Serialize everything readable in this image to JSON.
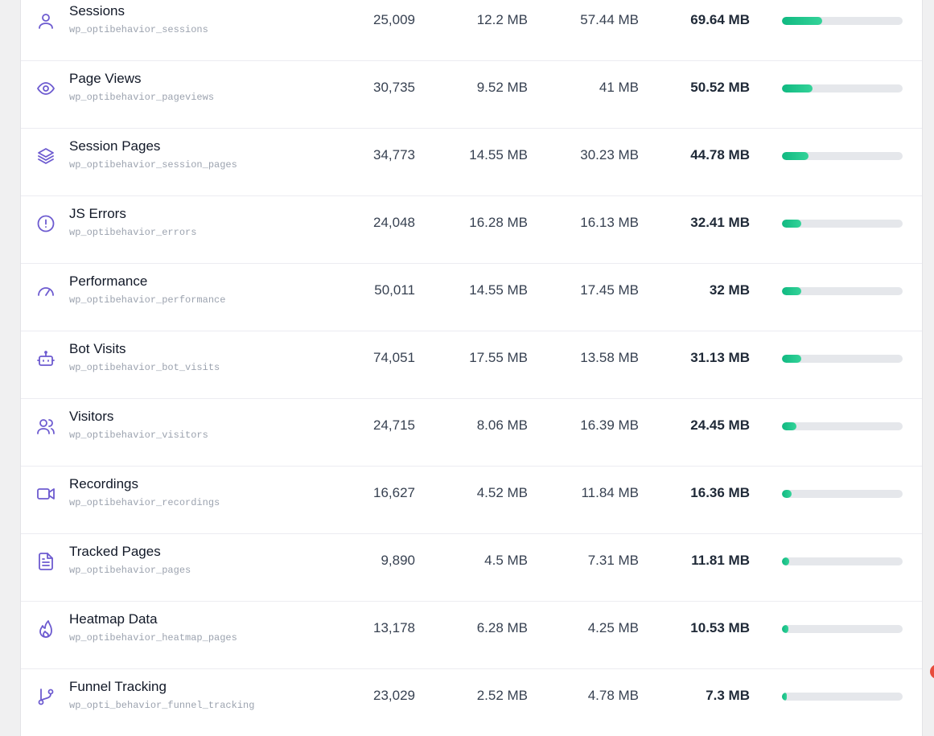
{
  "accent_color": "#6d5bd0",
  "bar_color": "#10b981",
  "rows": [
    {
      "name": "Sessions",
      "table": "wp_optibehavior_sessions",
      "rows": "25,009",
      "data": "12.2 MB",
      "index": "57.44 MB",
      "total": "69.64 MB",
      "share": 0.33,
      "icon": "user-icon"
    },
    {
      "name": "Page Views",
      "table": "wp_optibehavior_pageviews",
      "rows": "30,735",
      "data": "9.52 MB",
      "index": "41 MB",
      "total": "50.52 MB",
      "share": 0.25,
      "icon": "eye-icon"
    },
    {
      "name": "Session Pages",
      "table": "wp_optibehavior_session_pages",
      "rows": "34,773",
      "data": "14.55 MB",
      "index": "30.23 MB",
      "total": "44.78 MB",
      "share": 0.22,
      "icon": "layers-icon"
    },
    {
      "name": "JS Errors",
      "table": "wp_optibehavior_errors",
      "rows": "24,048",
      "data": "16.28 MB",
      "index": "16.13 MB",
      "total": "32.41 MB",
      "share": 0.16,
      "icon": "alert-circle-icon"
    },
    {
      "name": "Performance",
      "table": "wp_optibehavior_performance",
      "rows": "50,011",
      "data": "14.55 MB",
      "index": "17.45 MB",
      "total": "32 MB",
      "share": 0.16,
      "icon": "gauge-icon"
    },
    {
      "name": "Bot Visits",
      "table": "wp_optibehavior_bot_visits",
      "rows": "74,051",
      "data": "17.55 MB",
      "index": "13.58 MB",
      "total": "31.13 MB",
      "share": 0.16,
      "icon": "bot-icon"
    },
    {
      "name": "Visitors",
      "table": "wp_optibehavior_visitors",
      "rows": "24,715",
      "data": "8.06 MB",
      "index": "16.39 MB",
      "total": "24.45 MB",
      "share": 0.12,
      "icon": "users-icon"
    },
    {
      "name": "Recordings",
      "table": "wp_optibehavior_recordings",
      "rows": "16,627",
      "data": "4.52 MB",
      "index": "11.84 MB",
      "total": "16.36 MB",
      "share": 0.08,
      "icon": "video-icon"
    },
    {
      "name": "Tracked Pages",
      "table": "wp_optibehavior_pages",
      "rows": "9,890",
      "data": "4.5 MB",
      "index": "7.31 MB",
      "total": "11.81 MB",
      "share": 0.06,
      "icon": "file-text-icon"
    },
    {
      "name": "Heatmap Data",
      "table": "wp_optibehavior_heatmap_pages",
      "rows": "13,178",
      "data": "6.28 MB",
      "index": "4.25 MB",
      "total": "10.53 MB",
      "share": 0.05,
      "icon": "flame-icon"
    },
    {
      "name": "Funnel Tracking",
      "table": "wp_opti_behavior_funnel_tracking",
      "rows": "23,029",
      "data": "2.52 MB",
      "index": "4.78 MB",
      "total": "7.3 MB",
      "share": 0.04,
      "icon": "git-branch-icon"
    }
  ]
}
